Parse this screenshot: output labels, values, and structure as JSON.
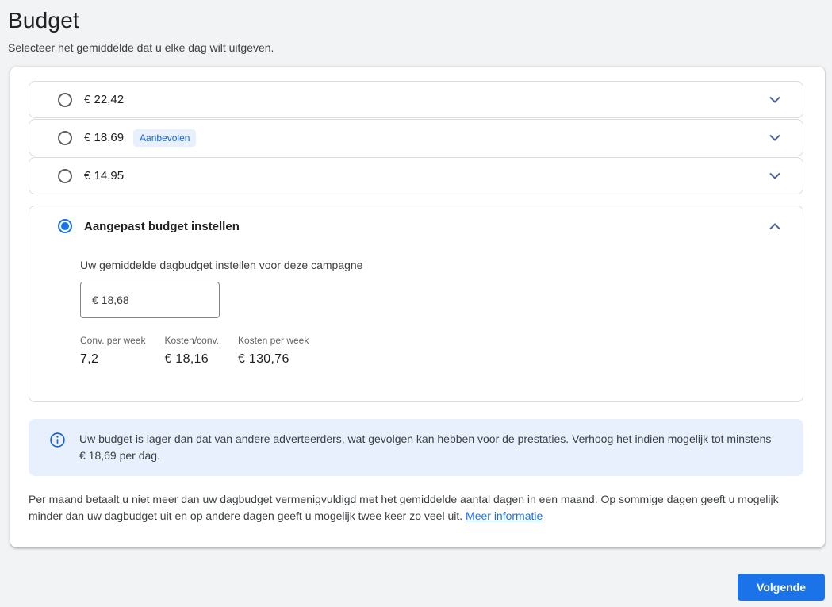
{
  "page": {
    "title": "Budget",
    "subtitle": "Selecteer het gemiddelde dat u elke dag wilt uitgeven."
  },
  "options": [
    {
      "label": "€ 22,42",
      "selected": false
    },
    {
      "label": "€ 18,69",
      "selected": false,
      "badge": "Aanbevolen"
    },
    {
      "label": "€ 14,95",
      "selected": false
    },
    {
      "label": "Aangepast budget instellen",
      "selected": true
    }
  ],
  "custom": {
    "input_label": "Uw gemiddelde dagbudget instellen voor deze campagne",
    "input_value": "€ 18,68",
    "stats": [
      {
        "label": "Conv. per week",
        "value": "7,2"
      },
      {
        "label": "Kosten/conv.",
        "value": "€ 18,16"
      },
      {
        "label": "Kosten per week",
        "value": "€ 130,76"
      }
    ]
  },
  "info_banner": {
    "text": "Uw budget is lager dan dat van andere adverteerders, wat gevolgen kan hebben voor de prestaties. Verhoog het indien mogelijk tot minstens € 18,69 per dag."
  },
  "footnote": {
    "text": "Per maand betaalt u niet meer dan uw dagbudget vermenigvuldigd met het gemiddelde aantal dagen in een maand. Op sommige dagen geeft u mogelijk minder dan uw dagbudget uit en op andere dagen geeft u mogelijk twee keer zo veel uit. ",
    "link": "Meer informatie"
  },
  "actions": {
    "next": "Volgende"
  },
  "colors": {
    "accent": "#1a73e8",
    "badge_bg": "#e8f0fe",
    "badge_text": "#1967d2",
    "banner_bg": "#e8f0fe",
    "chevron": "#51629b",
    "page_bg": "#f1f3f4",
    "row_border": "#dadce0"
  }
}
